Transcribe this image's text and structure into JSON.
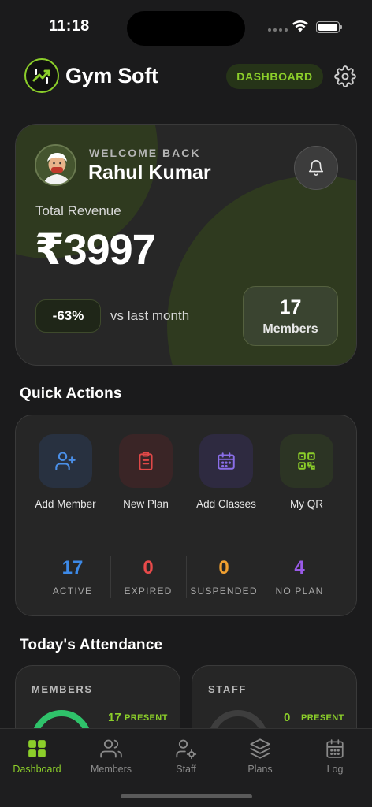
{
  "status_bar": {
    "time": "11:18"
  },
  "header": {
    "app_name": "Gym Soft",
    "badge": "DASHBOARD"
  },
  "hero": {
    "welcome": "WELCOME BACK",
    "user_name": "Rahul Kumar",
    "revenue_label": "Total Revenue",
    "revenue_value": "₹3997",
    "change": "-63%",
    "change_caption": "vs last month",
    "members_count": "17",
    "members_label": "Members"
  },
  "quick_actions": {
    "title": "Quick Actions",
    "items": [
      {
        "label": "Add Member",
        "icon": "add-user-icon",
        "color": "#4a8fe8"
      },
      {
        "label": "New Plan",
        "icon": "clipboard-icon",
        "color": "#e04848"
      },
      {
        "label": "Add Classes",
        "icon": "calendar-icon",
        "color": "#8a6ee8"
      },
      {
        "label": "My QR",
        "icon": "qr-code-icon",
        "color": "#8ccf2a"
      }
    ],
    "stats": [
      {
        "value": "17",
        "label": "ACTIVE",
        "color": "#3d8ae8"
      },
      {
        "value": "0",
        "label": "EXPIRED",
        "color": "#e84a4a"
      },
      {
        "value": "0",
        "label": "SUSPENDED",
        "color": "#f0a030"
      },
      {
        "value": "4",
        "label": "NO PLAN",
        "color": "#9a5ae8"
      }
    ]
  },
  "attendance": {
    "title": "Today's Attendance",
    "members": {
      "title": "MEMBERS",
      "count": "17",
      "status": "PRESENT"
    },
    "staff": {
      "title": "STAFF",
      "count": "0",
      "status": "PRESENT"
    }
  },
  "tabs": [
    {
      "label": "Dashboard",
      "icon": "grid-icon"
    },
    {
      "label": "Members",
      "icon": "users-icon"
    },
    {
      "label": "Staff",
      "icon": "staff-gear-icon"
    },
    {
      "label": "Plans",
      "icon": "layers-icon"
    },
    {
      "label": "Log",
      "icon": "calendar-icon"
    }
  ],
  "colors": {
    "accent": "#8ccf2a",
    "background": "#1b1b1c",
    "card": "#262626"
  }
}
